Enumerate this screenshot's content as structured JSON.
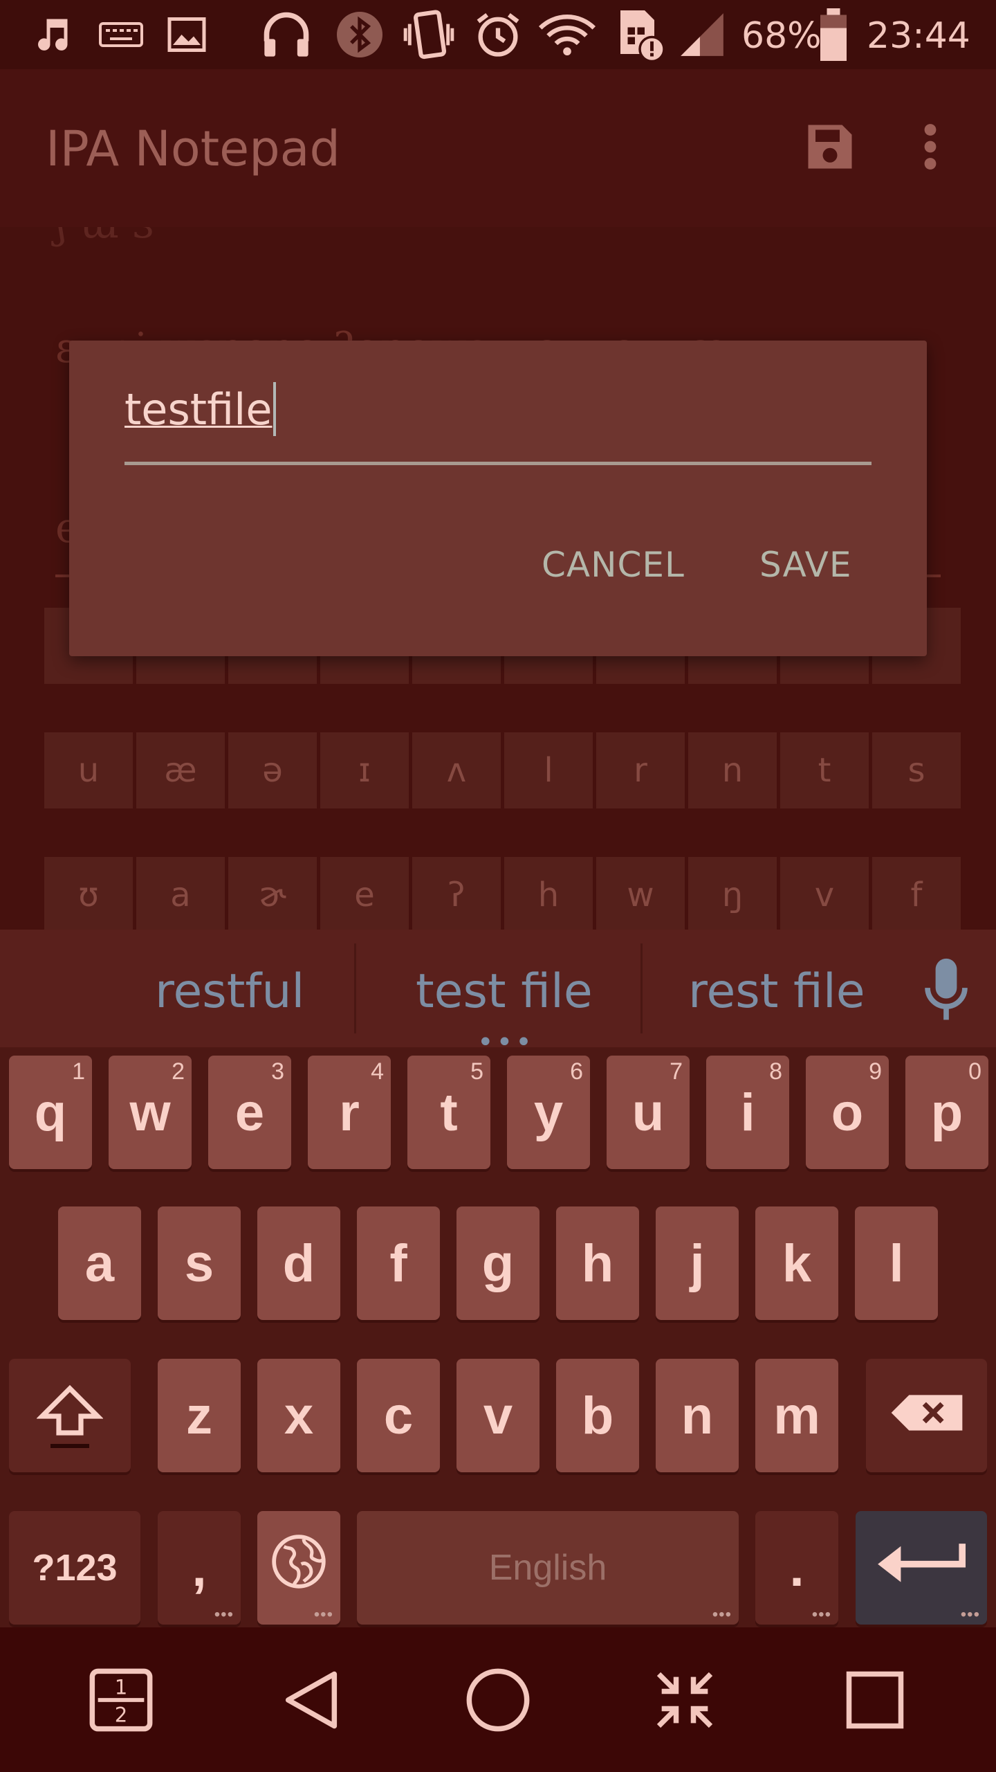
{
  "status_bar": {
    "battery_percent": "68%",
    "time": "23:44",
    "icons": [
      "music-note-icon",
      "keyboard-icon",
      "image-icon",
      "headphones-icon",
      "bluetooth-icon",
      "vibrate-icon",
      "alarm-icon",
      "wifi-icon",
      "sim-alert-icon",
      "signal-icon",
      "battery-icon"
    ]
  },
  "app_bar": {
    "title": "IPA Notepad",
    "icons": [
      "save-icon",
      "more-vert-icon"
    ]
  },
  "background": {
    "ipa_text_1": "ɛɹ ʌj wɛnənə ʔənəwɜɹ ɪə ɯə ɯæ",
    "ipa_text_2": "e",
    "ipa_keys_row1": [
      "",
      "",
      "",
      "",
      "",
      "",
      "",
      "",
      "",
      ""
    ],
    "ipa_keys_row2": [
      "u",
      "æ",
      "ə",
      "ɪ",
      "ʌ",
      "l",
      "r",
      "n",
      "t",
      "s"
    ],
    "ipa_keys_row3": [
      "ʊ",
      "a",
      "ɚ",
      "e",
      "ʔ",
      "h",
      "w",
      "ŋ",
      "v",
      "f"
    ]
  },
  "dialog": {
    "input_value": "testfile",
    "cancel_label": "CANCEL",
    "save_label": "SAVE"
  },
  "keyboard": {
    "suggestions": [
      "restful",
      "test file",
      "rest file"
    ],
    "suggestion_dots": "•••",
    "row1": [
      {
        "label": "q",
        "hint": "1"
      },
      {
        "label": "w",
        "hint": "2"
      },
      {
        "label": "e",
        "hint": "3"
      },
      {
        "label": "r",
        "hint": "4"
      },
      {
        "label": "t",
        "hint": "5"
      },
      {
        "label": "y",
        "hint": "6"
      },
      {
        "label": "u",
        "hint": "7"
      },
      {
        "label": "i",
        "hint": "8"
      },
      {
        "label": "o",
        "hint": "9"
      },
      {
        "label": "p",
        "hint": "0"
      }
    ],
    "row2": [
      "a",
      "s",
      "d",
      "f",
      "g",
      "h",
      "j",
      "k",
      "l"
    ],
    "row3": [
      "z",
      "x",
      "c",
      "v",
      "b",
      "n",
      "m"
    ],
    "symbols_label": "?123",
    "comma_label": ",",
    "space_label": "English",
    "period_label": ".",
    "more_dots": "•••"
  },
  "nav_bar": {
    "buttons": [
      "split-screen-icon",
      "back-icon",
      "home-icon",
      "collapse-icon",
      "recents-icon"
    ],
    "split_top": "1",
    "split_bottom": "2"
  }
}
